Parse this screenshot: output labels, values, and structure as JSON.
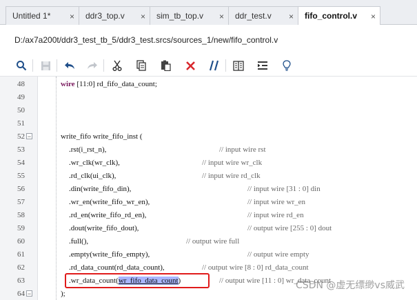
{
  "tabs": [
    {
      "label": "Untitled 1*",
      "active": false
    },
    {
      "label": "ddr3_top.v",
      "active": false
    },
    {
      "label": "sim_tb_top.v",
      "active": false
    },
    {
      "label": "ddr_test.v",
      "active": false
    },
    {
      "label": "fifo_control.v",
      "active": true
    }
  ],
  "tab_close_glyph": "×",
  "path": "D:/ax7a200t/ddr3_test_tb_5/ddr3_test.srcs/sources_1/new/fifo_control.v",
  "toolbar_icons": [
    "search-icon",
    "save-icon",
    "undo-icon",
    "redo-icon",
    "cut-icon",
    "copy-icon",
    "paste-icon",
    "delete-icon",
    "comment-icon",
    "columns-icon",
    "indent-icon",
    "lightbulb-icon"
  ],
  "code": {
    "line48": {
      "num": "48",
      "kw": "wire",
      "rest": " [11:0] rd_fifo_data_count;"
    },
    "line49": {
      "num": "49"
    },
    "line50": {
      "num": "50"
    },
    "line51": {
      "num": "51"
    },
    "line52": {
      "num": "52",
      "text": "write_fifo write_fifo_inst ("
    },
    "line53": {
      "num": "53",
      "text": ".rst(i_rst_n),",
      "comment": "// input wire rst"
    },
    "line54": {
      "num": "54",
      "text": ".wr_clk(wr_clk),",
      "comment": "// input wire wr_clk"
    },
    "line55": {
      "num": "55",
      "text": ".rd_clk(ui_clk),",
      "comment": "// input wire rd_clk"
    },
    "line56": {
      "num": "56",
      "text": ".din(write_fifo_din),",
      "comment": "// input wire [31 : 0] din"
    },
    "line57": {
      "num": "57",
      "text": ".wr_en(write_fifo_wr_en),",
      "comment": "// input wire wr_en"
    },
    "line58": {
      "num": "58",
      "text": ".rd_en(write_fifo_rd_en),",
      "comment": "// input wire rd_en"
    },
    "line59": {
      "num": "59",
      "text": ".dout(write_fifo_dout),",
      "comment": "// output wire [255 : 0] dout"
    },
    "line60": {
      "num": "60",
      "text": ".full(),",
      "comment": "// output wire full"
    },
    "line61": {
      "num": "61",
      "text": ".empty(write_fifo_empty),",
      "comment": "// output wire empty"
    },
    "line62": {
      "num": "62",
      "text": ".rd_data_count(rd_data_count),",
      "comment": "// output wire [8 : 0] rd_data_count"
    },
    "line63": {
      "num": "63",
      "pre": ".wr_data_count(",
      "hl": "wr_fifo_data_count",
      "post": ")",
      "comment": "// output wire [11 : 0] wr_data_count"
    },
    "line64": {
      "num": "64",
      "text": ");"
    }
  },
  "watermark": "CSDN @虚无缥缈vs威武"
}
